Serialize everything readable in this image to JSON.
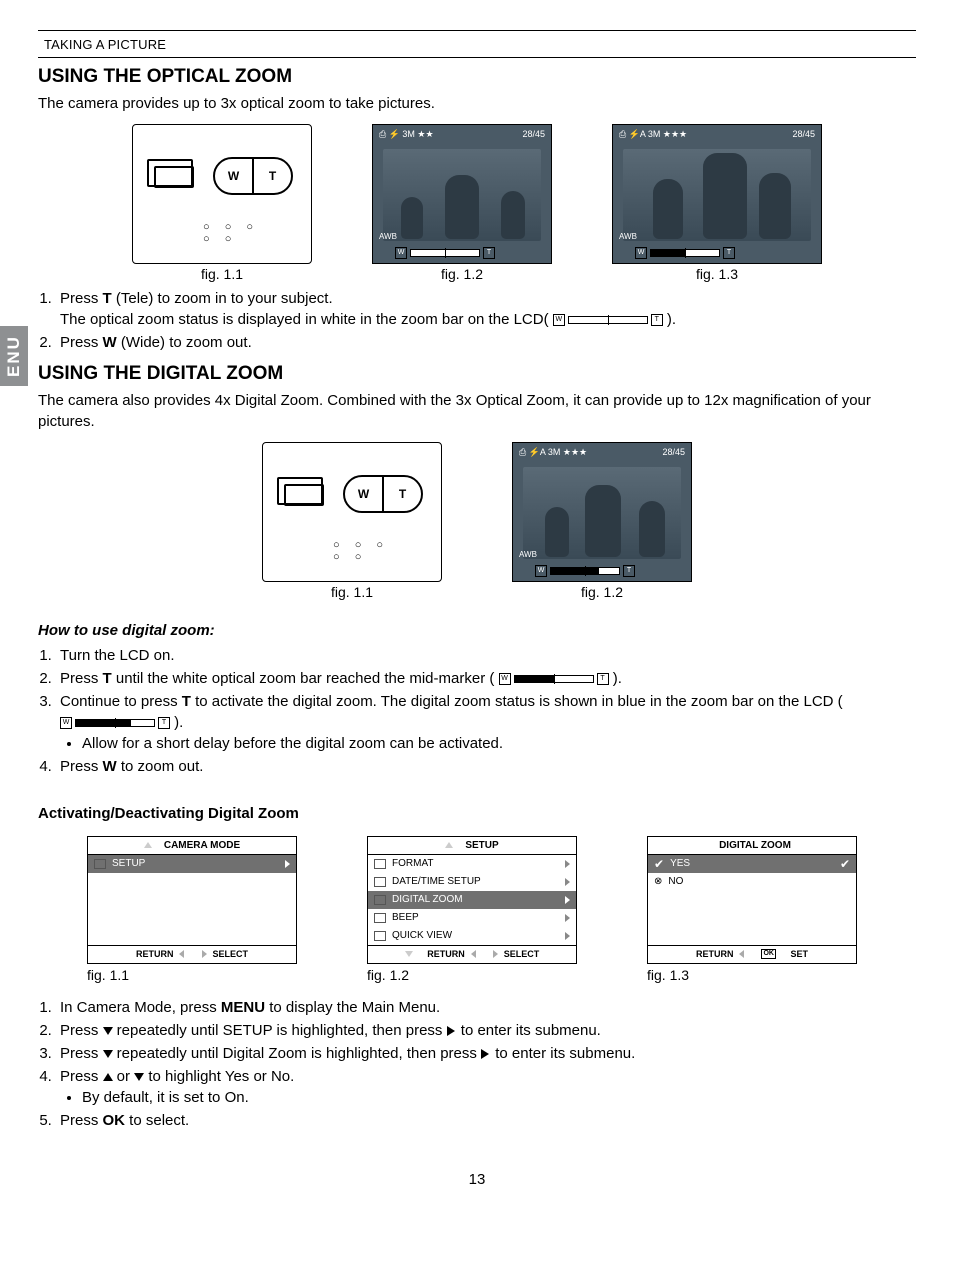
{
  "header": {
    "section": "TAKING A PICTURE"
  },
  "side_tab": "ENU",
  "optical": {
    "title": "USING THE OPTICAL ZOOM",
    "intro": "The camera provides up to 3x optical zoom to take pictures.",
    "figs": {
      "f1": "fig. 1.1",
      "f2": "fig. 1.2",
      "f3": "fig. 1.3"
    },
    "step1_a": "Press ",
    "step1_b": "T",
    "step1_c": " (Tele) to zoom in to your subject.",
    "step1_line2_a": "The optical zoom status is displayed in white in the zoom bar on the LCD( ",
    "step1_line2_b": " ).",
    "step2_a": "Press ",
    "step2_b": "W",
    "step2_c": " (Wide) to zoom out."
  },
  "digital": {
    "title": "USING THE DIGITAL ZOOM",
    "intro": "The camera also provides 4x Digital Zoom. Combined with the 3x Optical Zoom, it can provide up to 12x magnification of your pictures.",
    "figs": {
      "f1": "fig. 1.1",
      "f2": "fig. 1.2"
    },
    "howto": "How to use digital zoom:",
    "s1": "Turn the LCD on.",
    "s2_a": "Press ",
    "s2_b": "T",
    "s2_c": " until the white optical zoom bar reached the mid-marker ( ",
    "s2_d": " ).",
    "s3_a": "Continue to press ",
    "s3_b": "T",
    "s3_c": " to activate the digital zoom. The digital zoom status is shown in blue in the zoom bar on the LCD ( ",
    "s3_d": ").",
    "s3_bullet": "Allow for a short delay before the digital zoom can be activated.",
    "s4_a": "Press ",
    "s4_b": "W",
    "s4_c": " to zoom out."
  },
  "activate": {
    "title": "Activating/Deactivating Digital Zoom",
    "menus": {
      "m1": {
        "header": "CAMERA MODE",
        "row_setup": "SETUP",
        "footer_return": "RETURN",
        "footer_select": "SELECT",
        "cap": "fig. 1.1"
      },
      "m2": {
        "header": "SETUP",
        "rows": {
          "r1": "FORMAT",
          "r2": "DATE/TIME SETUP",
          "r3": "DIGITAL ZOOM",
          "r4": "BEEP",
          "r5": "QUICK VIEW"
        },
        "footer_return": "RETURN",
        "footer_select": "SELECT",
        "cap": "fig. 1.2"
      },
      "m3": {
        "header": "DIGITAL  ZOOM",
        "yes": "YES",
        "no": "NO",
        "footer_return": "RETURN",
        "footer_set": "SET",
        "ok": "OK",
        "cap": "fig. 1.3"
      }
    },
    "s1_a": "In Camera Mode, press ",
    "s1_b": "MENU",
    "s1_c": " to display the Main Menu.",
    "s2_a": "Press ",
    "s2_b": " repeatedly until SETUP is highlighted, then press ",
    "s2_c": " to enter its submenu.",
    "s3_a": "Press ",
    "s3_b": " repeatedly until Digital Zoom is highlighted, then press ",
    "s3_c": " to enter its submenu.",
    "s4_a": "Press ",
    "s4_b": " or ",
    "s4_c": " to highlight Yes or No.",
    "s4_bullet": "By default, it is set to On.",
    "s5_a": "Press ",
    "s5_b": "OK",
    "s5_c": " to select."
  },
  "page_number": "13",
  "lcd": {
    "awb": "AWB",
    "counter1": "28/45",
    "top_icons": "⎙  ⚡  3M ★★",
    "top_icons2": "⎙  ⚡A  3M ★★★"
  }
}
